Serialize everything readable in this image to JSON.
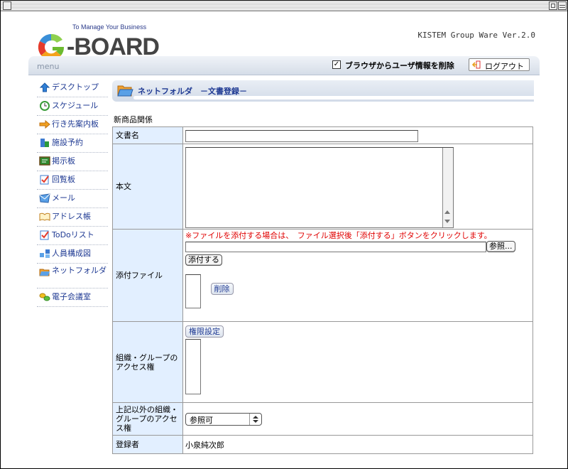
{
  "app": {
    "logo_tagline": "To Manage Your Business",
    "logo_text": "-BOARD",
    "version": "KISTEM Group Ware Ver.2.0"
  },
  "topbar": {
    "menu_title": "menu",
    "checkbox_checked": true,
    "checkbox_label": "ブラウザからユーザ情報を削除",
    "logout_label": "ログアウト"
  },
  "sidebar": {
    "items": [
      {
        "label": "デスクトップ",
        "icon": "up-arrow-icon"
      },
      {
        "label": "スケジュール",
        "icon": "clock-icon"
      },
      {
        "label": "行き先案内板",
        "icon": "right-arrow-icon"
      },
      {
        "label": "施設予約",
        "icon": "building-icon"
      },
      {
        "label": "掲示板",
        "icon": "bulletin-board-icon"
      },
      {
        "label": "回覧板",
        "icon": "checklist-icon"
      },
      {
        "label": "メール",
        "icon": "mail-icon"
      },
      {
        "label": "アドレス帳",
        "icon": "address-book-icon"
      },
      {
        "label": "ToDoリスト",
        "icon": "todo-icon"
      },
      {
        "label": "人員構成図",
        "icon": "org-chart-icon"
      },
      {
        "label": "ネットフォルダ",
        "icon": "folder-icon"
      },
      {
        "label": "電子会議室",
        "icon": "conference-icon"
      }
    ]
  },
  "page": {
    "header_title": "ネットフォルダ　－文書登録－",
    "caption": "新商品関係"
  },
  "form": {
    "doc_name_label": "文書名",
    "doc_name_value": "",
    "body_label": "本文",
    "body_value": "",
    "attachment_label": "添付ファイル",
    "attachment_note": "※ファイルを添付する場合は、　ファイル選択後「添付する」ボタンをクリックします。",
    "browse_label": "参照...",
    "attach_button": "添付する",
    "delete_button": "削除",
    "org_access_label": "組織・グループのアクセス権",
    "permission_button": "権限設定",
    "other_access_label": "上記以外の組織・グループのアクセス権",
    "other_access_value": "参照可",
    "registrant_label": "登録者",
    "registrant_value": "小泉純次郎"
  }
}
